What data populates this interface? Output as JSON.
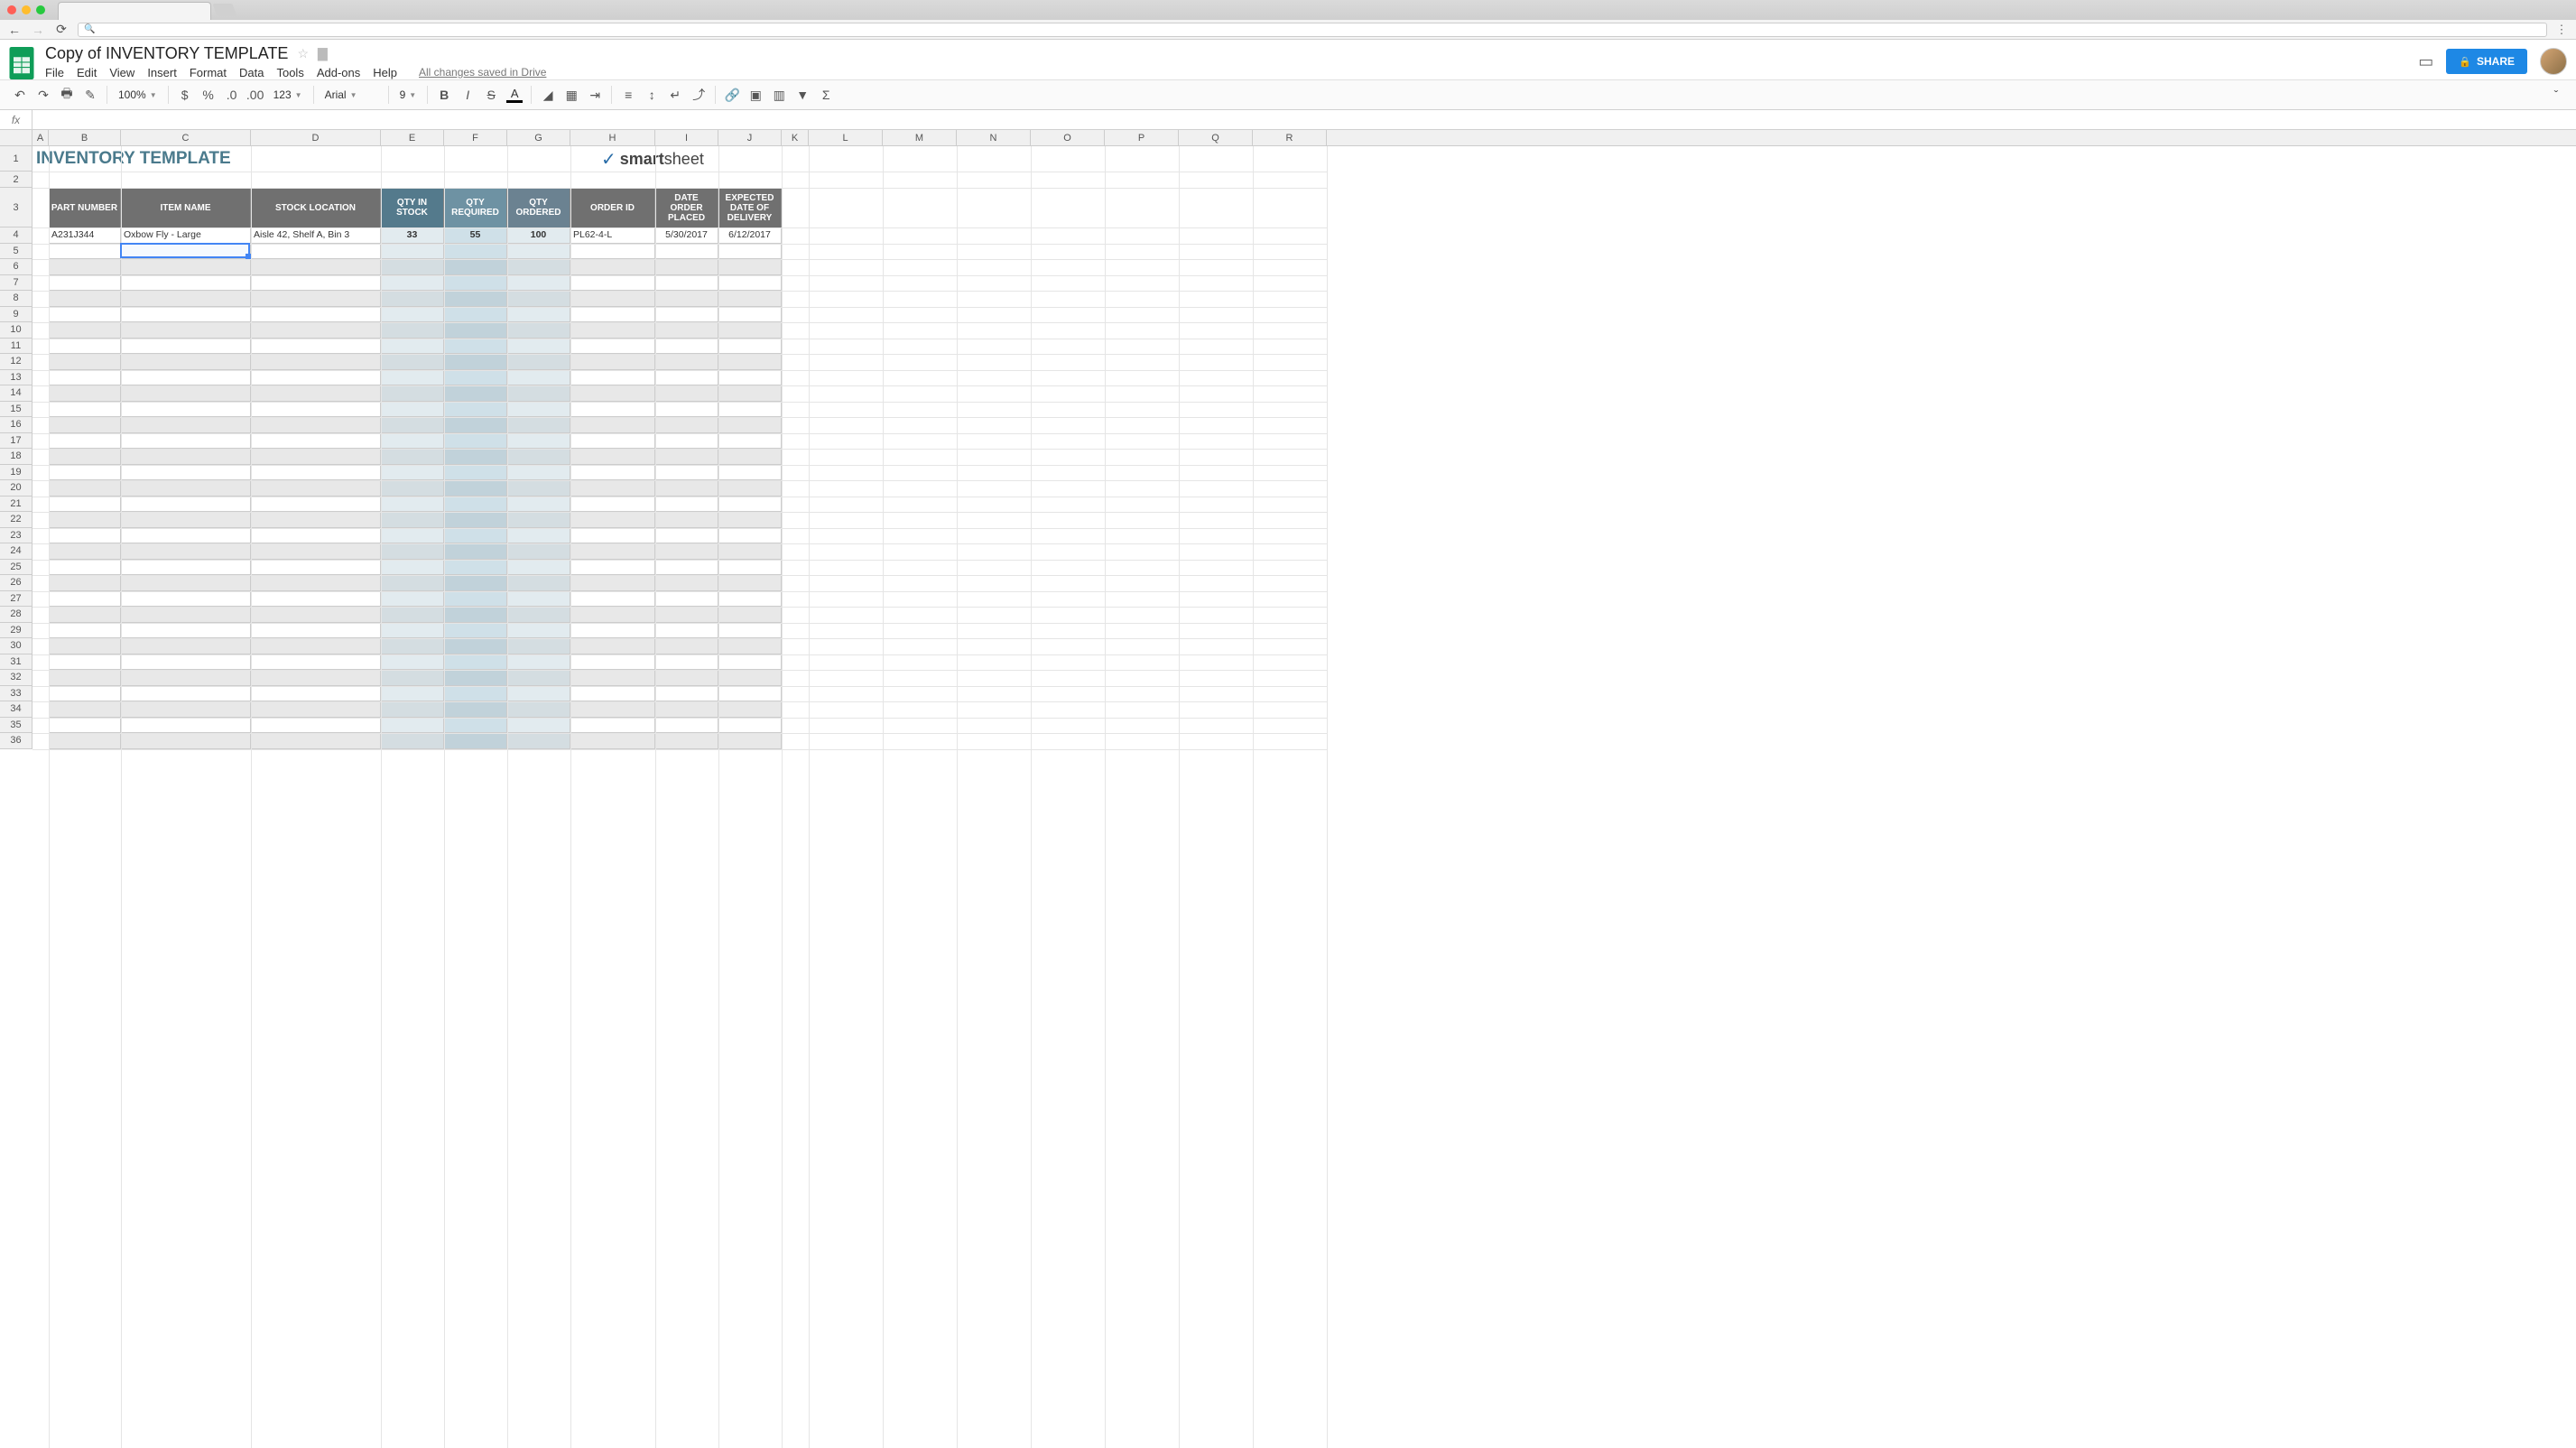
{
  "doc": {
    "title": "Copy of INVENTORY TEMPLATE",
    "save_status": "All changes saved in Drive"
  },
  "menu": {
    "file": "File",
    "edit": "Edit",
    "view": "View",
    "insert": "Insert",
    "format": "Format",
    "data": "Data",
    "tools": "Tools",
    "addons": "Add-ons",
    "help": "Help"
  },
  "share_label": "SHARE",
  "toolbar": {
    "zoom": "100%",
    "font": "Arial",
    "size": "9",
    "num_format": "123"
  },
  "col_widths": {
    "A": 18,
    "B": 80,
    "C": 144,
    "D": 144,
    "E": 70,
    "F": 70,
    "G": 70,
    "H": 94,
    "I": 70,
    "J": 70,
    "K": 30,
    "L": 82,
    "M": 82,
    "N": 82,
    "O": 82,
    "P": 82,
    "Q": 82,
    "R": 82
  },
  "columns": [
    "A",
    "B",
    "C",
    "D",
    "E",
    "F",
    "G",
    "H",
    "I",
    "J",
    "K",
    "L",
    "M",
    "N",
    "O",
    "P",
    "Q",
    "R"
  ],
  "inv_title": "INVENTORY TEMPLATE",
  "brand_logo": "smartsheet",
  "table_headers": [
    {
      "label": "PART NUMBER",
      "w": 80,
      "style": ""
    },
    {
      "label": "ITEM NAME",
      "w": 144,
      "style": ""
    },
    {
      "label": "STOCK LOCATION",
      "w": 144,
      "style": ""
    },
    {
      "label": "QTY IN STOCK",
      "w": 70,
      "style": "alt1"
    },
    {
      "label": "QTY REQUIRED",
      "w": 70,
      "style": "alt2"
    },
    {
      "label": "QTY ORDERED",
      "w": 70,
      "style": "alt3"
    },
    {
      "label": "ORDER ID",
      "w": 94,
      "style": ""
    },
    {
      "label": "DATE ORDER PLACED",
      "w": 70,
      "style": ""
    },
    {
      "label": "EXPECTED DATE OF DELIVERY",
      "w": 70,
      "style": ""
    }
  ],
  "data_row": {
    "part": "A231J344",
    "item": "Oxbow Fly - Large",
    "loc": "Aisle 42, Shelf A, Bin 3",
    "stock": "33",
    "req": "55",
    "ord": "100",
    "order_id": "PL62-4-L",
    "date_placed": "5/30/2017",
    "date_expected": "6/12/2017"
  },
  "selected_cell": "C5"
}
